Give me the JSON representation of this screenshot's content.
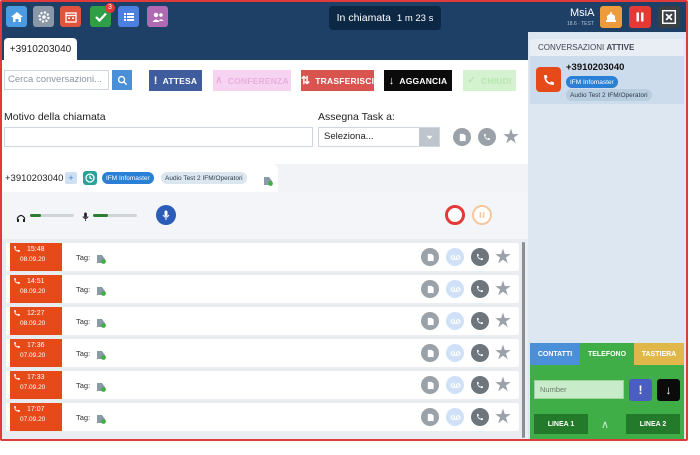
{
  "topbar": {
    "call_status": "In chiamata",
    "call_duration": "1 m 23 s",
    "tasks_badge": "3",
    "user_name": "MsiA",
    "user_sub": "18.6 · TEST"
  },
  "tabs": {
    "active_tab": "+3910203040"
  },
  "toolbar": {
    "search_placeholder": "Cerca conversazioni...",
    "hold_label": "ATTESA",
    "conference_label": "CONFERENZA",
    "transfer_label": "TRASFERISCI",
    "hangup_label": "AGGANCIA",
    "close_label": "CHIUDI"
  },
  "form": {
    "reason_label": "Motivo della chiamata",
    "task_label": "Assegna Task a:",
    "task_select_value": "Seleziona..."
  },
  "call_tab": {
    "number": "+3910203040",
    "pill_company": "IFM Infomaster",
    "pill_queue": "Audio Test 2 IFM/Operatori"
  },
  "log": {
    "tag_label": "Tag:",
    "rows": [
      {
        "time": "15:48",
        "date": "08.09.20"
      },
      {
        "time": "14:51",
        "date": "08.09.20"
      },
      {
        "time": "12:27",
        "date": "08.09.20"
      },
      {
        "time": "17:36",
        "date": "07.09.20"
      },
      {
        "time": "17:33",
        "date": "07.09.20"
      },
      {
        "time": "17:07",
        "date": "07.09.20"
      }
    ]
  },
  "sidebar": {
    "heading_prefix": "CONVERSAZIONI",
    "heading_suffix": "ATTIVE",
    "conv_number": "+3910203040",
    "conv_company": "IFM Infomaster",
    "conv_queue": "Audio Test 2 IFM/Operatori"
  },
  "dialpad": {
    "tab_contacts": "CONTATTI",
    "tab_phone": "TELEFONO",
    "tab_keypad": "TASTIERA",
    "number_placeholder": "Number",
    "line1": "LINEA 1",
    "line2": "LINEA 2"
  },
  "levels": {
    "headphone_volume": 0.25,
    "mic_volume": 0.35
  },
  "colors": {
    "topbar": "#1e3f66",
    "hangup_orange": "#e64a19",
    "green_panel": "#3fae46",
    "accent_blue": "#2a7fd6"
  }
}
